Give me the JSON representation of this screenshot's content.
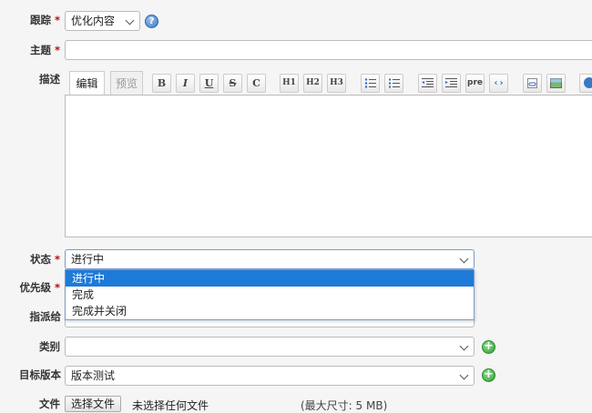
{
  "form": {
    "tracker": {
      "label": "跟踪",
      "value": "优化内容",
      "help": "?"
    },
    "subject": {
      "label": "主题"
    },
    "description": {
      "label": "描述",
      "tab_edit": "编辑",
      "tab_preview": "预览",
      "toolbar": [
        "B",
        "I",
        "U",
        "S",
        "C",
        "H1",
        "H2",
        "H3",
        "pre"
      ]
    },
    "status": {
      "label": "状态",
      "value": "进行中",
      "options": [
        "进行中",
        "完成",
        "完成并关闭"
      ]
    },
    "priority": {
      "label": "优先级"
    },
    "assignee": {
      "label": "指派给"
    },
    "category": {
      "label": "类别",
      "value": "",
      "add": "+"
    },
    "target_version": {
      "label": "目标版本",
      "value": "版本测试",
      "add": "+"
    },
    "files": {
      "label": "文件",
      "button": "选择文件",
      "no_file": "未选择任何文件",
      "max_size": "(最大尺寸: 5 MB)"
    },
    "required_mark": "*"
  },
  "colors": {
    "background": "#f5f5f5",
    "required": "#cc0000",
    "selected_option": "#1e7ad7"
  }
}
